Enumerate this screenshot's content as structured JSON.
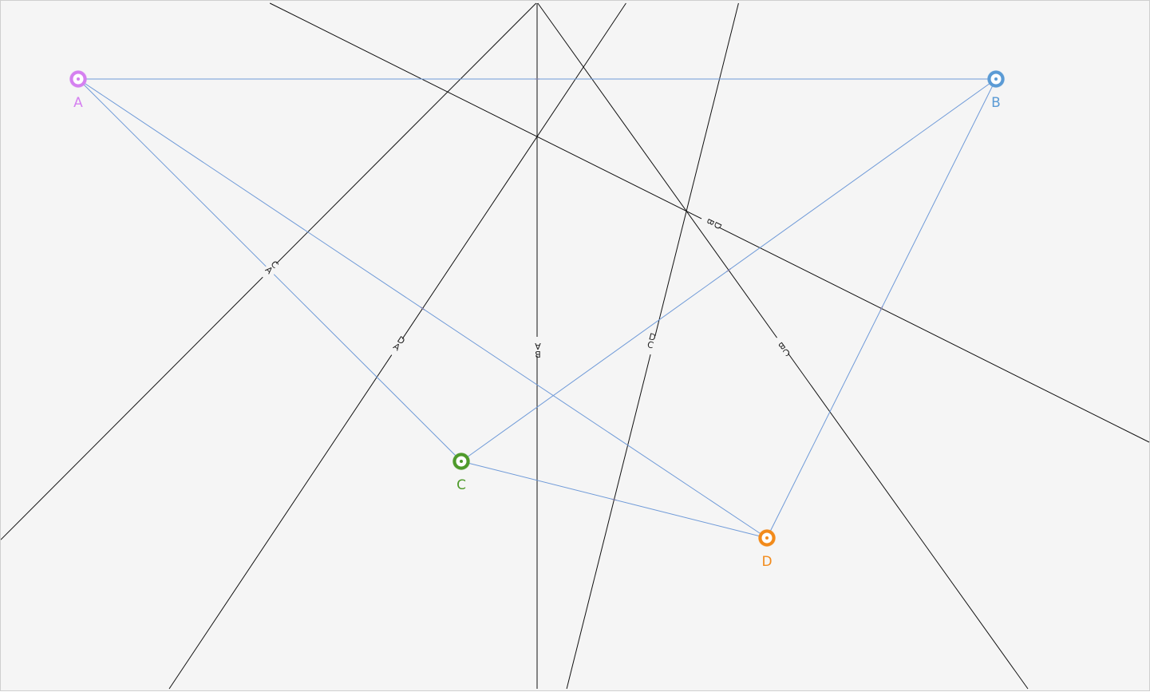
{
  "diagram": {
    "points": [
      {
        "id": "A",
        "label": "A",
        "color": "#d580f0"
      },
      {
        "id": "B",
        "label": "B",
        "color": "#5b9bd5"
      },
      {
        "id": "C",
        "label": "C",
        "color": "#4e9a2a"
      },
      {
        "id": "D",
        "label": "D",
        "color": "#f28a1a"
      }
    ],
    "segments": [
      {
        "from": "A",
        "to": "B"
      },
      {
        "from": "A",
        "to": "C"
      },
      {
        "from": "A",
        "to": "D"
      },
      {
        "from": "B",
        "to": "C"
      },
      {
        "from": "B",
        "to": "D"
      },
      {
        "from": "C",
        "to": "D"
      }
    ],
    "bisectors": [
      {
        "pair": [
          "A",
          "B"
        ],
        "label_a": "A",
        "label_b": "B"
      },
      {
        "pair": [
          "A",
          "C"
        ],
        "label_a": "A",
        "label_b": "C"
      },
      {
        "pair": [
          "A",
          "D"
        ],
        "label_a": "A",
        "label_b": "D"
      },
      {
        "pair": [
          "B",
          "C"
        ],
        "label_a": "B",
        "label_b": "C"
      },
      {
        "pair": [
          "B",
          "D"
        ],
        "label_a": "B",
        "label_b": "D"
      },
      {
        "pair": [
          "C",
          "D"
        ],
        "label_a": "C",
        "label_b": "D"
      }
    ],
    "segment_color": "#6f9ad8",
    "bisector_color": "#111111",
    "midpoint_tick_color": "#c0392b"
  }
}
